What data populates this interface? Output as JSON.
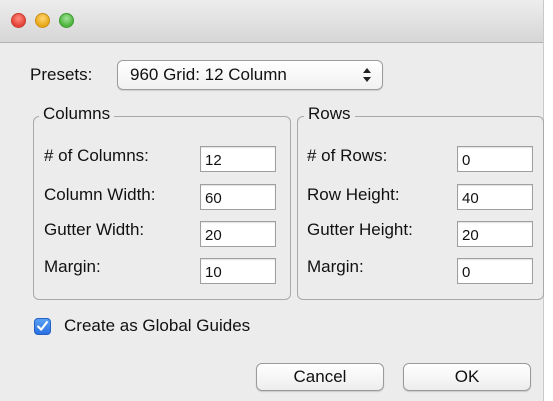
{
  "presets": {
    "label": "Presets:",
    "selected": "960 Grid: 12 Column"
  },
  "columns": {
    "title": "Columns",
    "fields": [
      {
        "label": "# of Columns:",
        "value": "12"
      },
      {
        "label": "Column Width:",
        "value": "60"
      },
      {
        "label": "Gutter Width:",
        "value": "20"
      },
      {
        "label": "Margin:",
        "value": "10"
      }
    ]
  },
  "rows": {
    "title": "Rows",
    "fields": [
      {
        "label": "# of Rows:",
        "value": "0"
      },
      {
        "label": "Row Height:",
        "value": "40"
      },
      {
        "label": "Gutter Height:",
        "value": "20"
      },
      {
        "label": "Margin:",
        "value": "0"
      }
    ]
  },
  "global_guides": {
    "label": "Create as Global Guides",
    "checked": true
  },
  "buttons": {
    "cancel": "Cancel",
    "ok": "OK"
  },
  "colors": {
    "window_bg": "#ececec",
    "accent": "#2a6fe0",
    "close": "#e5453a",
    "minimize": "#e8a91c",
    "zoom": "#4fb63f"
  }
}
